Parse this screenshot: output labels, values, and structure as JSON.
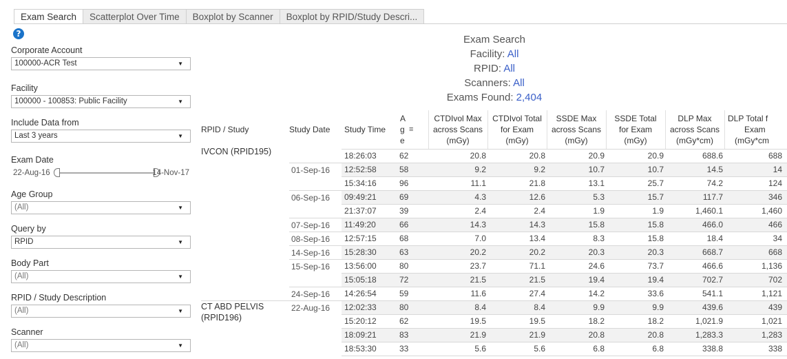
{
  "tabs": [
    "Exam Search",
    "Scatterplot Over Time",
    "Boxplot by Scanner",
    "Boxplot by RPID/Study Descri..."
  ],
  "help_glyph": "?",
  "filters": {
    "corporate_account": {
      "label": "Corporate Account",
      "value": "100000-ACR Test"
    },
    "facility": {
      "label": "Facility",
      "value": "100000 - 100853: Public Facility"
    },
    "include_data": {
      "label": "Include Data from",
      "value": "Last 3 years"
    },
    "exam_date": {
      "label": "Exam Date",
      "start": "22-Aug-16",
      "end": "14-Nov-17"
    },
    "age_group": {
      "label": "Age Group",
      "value": "(All)"
    },
    "query_by": {
      "label": "Query by",
      "value": "RPID"
    },
    "body_part": {
      "label": "Body Part",
      "value": "(All)"
    },
    "rpid_study": {
      "label": "RPID / Study Description",
      "value": "(All)"
    },
    "scanner": {
      "label": "Scanner",
      "value": "(All)"
    }
  },
  "summary": {
    "title": "Exam Search",
    "facility_label": "Facility:",
    "facility_value": "All",
    "rpid_label": "RPID:",
    "rpid_value": "All",
    "scanners_label": "Scanners:",
    "scanners_value": "All",
    "exams_label": "Exams Found:",
    "exams_value": "2,404"
  },
  "table": {
    "headers": {
      "rpid_study": "RPID / Study",
      "study_date": "Study Date",
      "study_time": "Study Time",
      "age": [
        "A",
        "g",
        "e"
      ],
      "ctdi_max": [
        "CTDIvol Max",
        "across Scans",
        "(mGy)"
      ],
      "ctdi_total": [
        "CTDIvol Total",
        "for Exam",
        "(mGy)"
      ],
      "ssde_max": [
        "SSDE Max",
        "across Scans",
        "(mGy)"
      ],
      "ssde_total": [
        "SSDE Total",
        "for Exam",
        "(mGy)"
      ],
      "dlp_max": [
        "DLP Max",
        "across Scans",
        "(mGy*cm)"
      ],
      "dlp_total": [
        "DLP Total f",
        "Exam",
        "(mGy*cm"
      ]
    },
    "groups": [
      {
        "label": [
          "IVCON (RPID195)"
        ]
      },
      {
        "label": [
          "CT ABD PELVIS",
          "(RPID196)"
        ]
      }
    ],
    "dates": [
      "01-Sep-16",
      "06-Sep-16",
      "07-Sep-16",
      "08-Sep-16",
      "14-Sep-16",
      "15-Sep-16",
      "24-Sep-16",
      "22-Aug-16"
    ],
    "rows": [
      {
        "time": "18:26:03",
        "age": "62",
        "ctdi_max": "20.8",
        "ctdi_total": "20.8",
        "ssde_max": "20.9",
        "ssde_total": "20.9",
        "dlp_max": "688.6",
        "dlp_total": "688"
      },
      {
        "time": "12:52:58",
        "age": "58",
        "ctdi_max": "9.2",
        "ctdi_total": "9.2",
        "ssde_max": "10.7",
        "ssde_total": "10.7",
        "dlp_max": "14.5",
        "dlp_total": "14"
      },
      {
        "time": "15:34:16",
        "age": "96",
        "ctdi_max": "11.1",
        "ctdi_total": "21.8",
        "ssde_max": "13.1",
        "ssde_total": "25.7",
        "dlp_max": "74.2",
        "dlp_total": "124"
      },
      {
        "time": "09:49:21",
        "age": "69",
        "ctdi_max": "4.3",
        "ctdi_total": "12.6",
        "ssde_max": "5.3",
        "ssde_total": "15.7",
        "dlp_max": "117.7",
        "dlp_total": "346"
      },
      {
        "time": "21:37:07",
        "age": "39",
        "ctdi_max": "2.4",
        "ctdi_total": "2.4",
        "ssde_max": "1.9",
        "ssde_total": "1.9",
        "dlp_max": "1,460.1",
        "dlp_total": "1,460"
      },
      {
        "time": "11:49:20",
        "age": "66",
        "ctdi_max": "14.3",
        "ctdi_total": "14.3",
        "ssde_max": "15.8",
        "ssde_total": "15.8",
        "dlp_max": "466.0",
        "dlp_total": "466"
      },
      {
        "time": "12:57:15",
        "age": "68",
        "ctdi_max": "7.0",
        "ctdi_total": "13.4",
        "ssde_max": "8.3",
        "ssde_total": "15.8",
        "dlp_max": "18.4",
        "dlp_total": "34"
      },
      {
        "time": "15:28:30",
        "age": "63",
        "ctdi_max": "20.2",
        "ctdi_total": "20.2",
        "ssde_max": "20.3",
        "ssde_total": "20.3",
        "dlp_max": "668.7",
        "dlp_total": "668"
      },
      {
        "time": "13:56:00",
        "age": "80",
        "ctdi_max": "23.7",
        "ctdi_total": "71.1",
        "ssde_max": "24.6",
        "ssde_total": "73.7",
        "dlp_max": "466.6",
        "dlp_total": "1,136"
      },
      {
        "time": "15:05:18",
        "age": "72",
        "ctdi_max": "21.5",
        "ctdi_total": "21.5",
        "ssde_max": "19.4",
        "ssde_total": "19.4",
        "dlp_max": "702.7",
        "dlp_total": "702"
      },
      {
        "time": "14:26:54",
        "age": "59",
        "ctdi_max": "11.6",
        "ctdi_total": "27.4",
        "ssde_max": "14.2",
        "ssde_total": "33.6",
        "dlp_max": "541.1",
        "dlp_total": "1,121"
      },
      {
        "time": "12:02:33",
        "age": "80",
        "ctdi_max": "8.4",
        "ctdi_total": "8.4",
        "ssde_max": "9.9",
        "ssde_total": "9.9",
        "dlp_max": "439.6",
        "dlp_total": "439"
      },
      {
        "time": "15:20:12",
        "age": "62",
        "ctdi_max": "19.5",
        "ctdi_total": "19.5",
        "ssde_max": "18.2",
        "ssde_total": "18.2",
        "dlp_max": "1,021.9",
        "dlp_total": "1,021"
      },
      {
        "time": "18:09:21",
        "age": "83",
        "ctdi_max": "21.9",
        "ctdi_total": "21.9",
        "ssde_max": "20.8",
        "ssde_total": "20.8",
        "dlp_max": "1,283.3",
        "dlp_total": "1,283"
      },
      {
        "time": "18:53:30",
        "age": "33",
        "ctdi_max": "5.6",
        "ctdi_total": "5.6",
        "ssde_max": "6.8",
        "ssde_total": "6.8",
        "dlp_max": "338.8",
        "dlp_total": "338"
      }
    ]
  },
  "colors": {
    "accent": "#3a5fc8",
    "help": "#1a73c9",
    "row_alt": "#f2f2f2"
  }
}
